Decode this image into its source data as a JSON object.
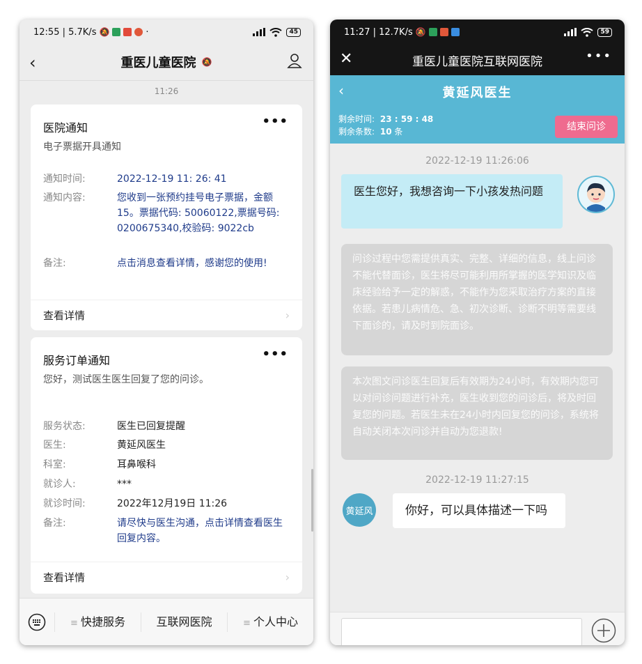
{
  "left": {
    "status": {
      "time_speed": "12:55 | 5.7K/s",
      "battery": "45"
    },
    "header": {
      "title": "重医儿童医院"
    },
    "chat_time": "11:26",
    "hospital_notice": {
      "title": "医院通知",
      "subtitle": "电子票据开具通知",
      "rows": [
        {
          "k": "通知时间:",
          "v": "2022-12-19 11: 26: 41"
        },
        {
          "k": "通知内容:",
          "v": "您收到一张预约挂号电子票据，金额15。票据代码: 50060122,票据号码: 0200675340,校验码: 9022cb"
        },
        {
          "k": "备注:",
          "v": "点击消息查看详情，感谢您的使用!"
        }
      ],
      "footer": "查看详情"
    },
    "order_notice": {
      "title": "服务订单通知",
      "subtitle": "您好，测试医生医生回复了您的问诊。",
      "rows": [
        {
          "k": "服务状态:",
          "v": "医生已回复提醒"
        },
        {
          "k": "医生:",
          "v": "黄延风医生"
        },
        {
          "k": "科室:",
          "v": "耳鼻喉科"
        },
        {
          "k": "就诊人:",
          "v": "***"
        },
        {
          "k": "就诊时间:",
          "v": "2022年12月19日 11:26"
        },
        {
          "k": "备注:",
          "v": "请尽快与医生沟通，点击详情查看医生回复内容。"
        }
      ],
      "footer": "查看详情"
    },
    "menu": {
      "item1": "快捷服务",
      "item2": "互联网医院",
      "item3": "个人中心"
    }
  },
  "right": {
    "status": {
      "time_speed": "11:27 | 12.7K/s",
      "battery": "59"
    },
    "topbar_title": "重医儿童医院互联网医院",
    "doctor_title": "黄延风医生",
    "remaining": {
      "time_label": "剩余时间:",
      "time_value": "23 : 59 : 48",
      "count_label": "剩余条数:",
      "count_value": "10",
      "count_unit": "条"
    },
    "end_button": "结束问诊",
    "timestamp1": "2022-12-19 11:26:06",
    "my_message": "医生您好，我想咨询一下小孩发热问题",
    "notice1": "问诊过程中您需提供真实、完整、详细的信息，线上问诊不能代替面诊，医生将尽可能利用所掌握的医学知识及临床经验给予一定的解惑，不能作为您采取治疗方案的直接依据。若患儿病情危、急、初次诊断、诊断不明等需要线下面诊的，请及时到院面诊。",
    "notice2": "本次图文问诊医生回复后有效期为24小时，有效期内您可以对问诊问题进行补充，医生收到您的问诊后，将及时回复您的问题。若医生未在24小时内回复您的问诊，系统将自动关闭本次问诊并自动为您退款!",
    "timestamp2": "2022-12-19 11:27:15",
    "doctor_avatar_text": "黄延风",
    "doctor_message": "你好，可以具体描述一下吗"
  },
  "colors": {
    "accent": "#58b7d4",
    "end_button": "#ef6b8f",
    "link_text": "#1f3b8a"
  }
}
